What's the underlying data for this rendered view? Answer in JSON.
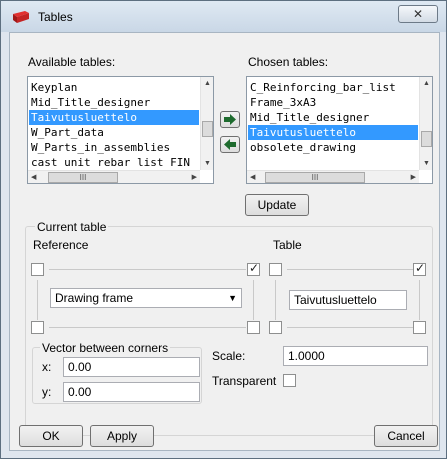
{
  "window": {
    "title": "Tables",
    "close_glyph": "✕"
  },
  "available": {
    "label": "Available tables:",
    "items": [
      "Keyplan",
      "Mid_Title_designer",
      "Taivutusluettelo",
      "W_Part_data",
      "W_Parts_in_assemblies",
      "cast unit rebar list FIN"
    ],
    "selected_index": 2,
    "hscroll_glyph": "III"
  },
  "chosen": {
    "label": "Chosen tables:",
    "items": [
      "C_Reinforcing_bar_list",
      "Frame_3xA3",
      "Mid_Title_designer",
      "Taivutusluettelo",
      "obsolete_drawing"
    ],
    "selected_index": 3,
    "hscroll_glyph": "III"
  },
  "update_label": "Update",
  "current": {
    "label": "Current table",
    "reference_label": "Reference",
    "table_label": "Table",
    "reference_value": "Drawing frame",
    "table_value": "Taivutusluettelo",
    "ref_top_left": false,
    "ref_top_right": true,
    "tbl_top_left": false,
    "tbl_top_right": true,
    "ref_bottom_left": false,
    "ref_bottom_right": false,
    "tbl_bottom_left": false,
    "tbl_bottom_right": false
  },
  "vector": {
    "label": "Vector between corners",
    "x_label": "x:",
    "x_value": "0.00",
    "y_label": "y:",
    "y_value": "0.00"
  },
  "scale": {
    "label": "Scale:",
    "value": "1.0000"
  },
  "transparent": {
    "label": "Transparent",
    "checked": false
  },
  "buttons": {
    "ok": "OK",
    "apply": "Apply",
    "cancel": "Cancel"
  },
  "colors": {
    "selection": "#3399ff",
    "arrow": "#1e6b2e"
  }
}
